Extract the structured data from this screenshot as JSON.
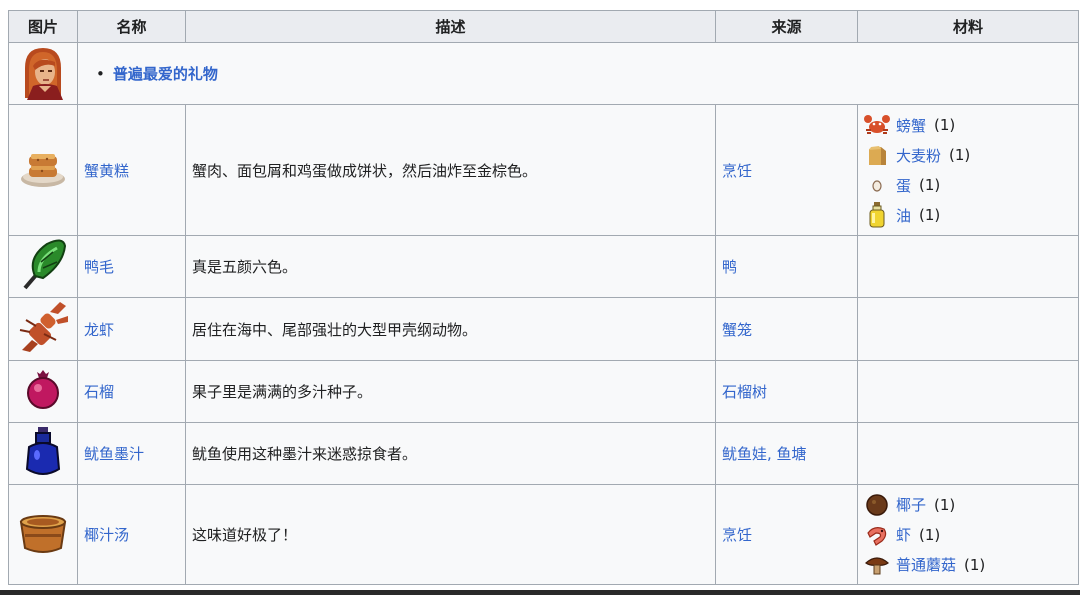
{
  "table": {
    "headers": [
      "图片",
      "名称",
      "描述",
      "来源",
      "材料"
    ],
    "character": {
      "portrait_icon": "red-haired-villager-portrait",
      "favorite_text": "普遍最爱的礼物"
    },
    "rows": [
      {
        "icon": "crab-cakes-icon",
        "name": "蟹黄糕",
        "description": "蟹肉、面包屑和鸡蛋做成饼状，然后油炸至金棕色。",
        "source": "烹饪",
        "materials": [
          {
            "icon": "crab-icon",
            "name": "螃蟹",
            "qty_open": "(",
            "qty": "1",
            "qty_close": ")"
          },
          {
            "icon": "wheat-flour-icon",
            "name": "大麦粉",
            "qty_open": "(",
            "qty": "1",
            "qty_close": ")"
          },
          {
            "icon": "egg-icon",
            "name": "蛋",
            "qty_open": "(",
            "qty": "1",
            "qty_close": ")"
          },
          {
            "icon": "oil-icon",
            "name": "油",
            "qty_open": "(",
            "qty": "1",
            "qty_close": ")"
          }
        ]
      },
      {
        "icon": "duck-feather-icon",
        "name": "鸭毛",
        "description": "真是五颜六色。",
        "source": "鸭",
        "materials": []
      },
      {
        "icon": "lobster-icon",
        "name": "龙虾",
        "description": "居住在海中、尾部强壮的大型甲壳纲动物。",
        "source": "蟹笼",
        "materials": []
      },
      {
        "icon": "pomegranate-icon",
        "name": "石榴",
        "description": "果子里是满满的多汁种子。",
        "source": "石榴树",
        "materials": []
      },
      {
        "icon": "squid-ink-icon",
        "name": "鱿鱼墨汁",
        "description": "鱿鱼使用这种墨汁来迷惑掠食者。",
        "source": "鱿鱼娃, 鱼塘",
        "materials": []
      },
      {
        "icon": "coconut-soup-icon",
        "name": "椰汁汤",
        "description": "这味道好极了！",
        "source": "烹饪",
        "materials": [
          {
            "icon": "coconut-icon",
            "name": "椰子",
            "qty_open": "(",
            "qty": "1",
            "qty_close": ")"
          },
          {
            "icon": "shrimp-icon",
            "name": "虾",
            "qty_open": "(",
            "qty": "1",
            "qty_close": ")"
          },
          {
            "icon": "mushroom-icon",
            "name": "普通蘑菇",
            "qty_open": "(",
            "qty": "1",
            "qty_close": ")"
          }
        ]
      }
    ]
  }
}
